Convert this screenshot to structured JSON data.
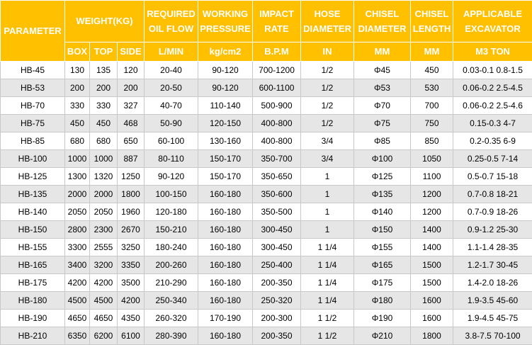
{
  "headers": {
    "parameter": "PARAMETER",
    "weight": "WEIGHT(KG)",
    "oil_flow": [
      "REQUIRED",
      "OIL FLOW"
    ],
    "pressure": [
      "WORKING",
      "PRESSURE"
    ],
    "impact": [
      "IMPACT",
      "RATE"
    ],
    "hose": [
      "HOSE",
      "DIAMETER"
    ],
    "chisel_dia": [
      "CHISEL",
      "DIAMETER"
    ],
    "chisel_len": [
      "CHISEL",
      "LENGTH"
    ],
    "excavator": [
      "APPLICABLE",
      "EXCAVATOR"
    ]
  },
  "units": {
    "box": "BOX",
    "top": "TOP",
    "side": "SIDE",
    "oil_flow": "L/MIN",
    "pressure": "kg/cm2",
    "impact": "B.P.M",
    "hose": "IN",
    "chisel_dia": "MM",
    "chisel_len": "MM",
    "excavator": "M3 TON"
  },
  "rows": [
    [
      "HB-45",
      "130",
      "135",
      "120",
      "20-40",
      "90-120",
      "700-1200",
      "1/2",
      "Φ45",
      "450",
      "0.03-0.1 0.8-1.5"
    ],
    [
      "HB-53",
      "200",
      "200",
      "200",
      "20-50",
      "90-120",
      "600-1100",
      "1/2",
      "Φ53",
      "530",
      "0.06-0.2 2.5-4.5"
    ],
    [
      "HB-70",
      "330",
      "330",
      "327",
      "40-70",
      "110-140",
      "500-900",
      "1/2",
      "Φ70",
      "700",
      "0.06-0.2 2.5-4.6"
    ],
    [
      "HB-75",
      "450",
      "450",
      "468",
      "50-90",
      "120-150",
      "400-800",
      "1/2",
      "Φ75",
      "750",
      "0.15-0.3 4-7"
    ],
    [
      "HB-85",
      "680",
      "680",
      "650",
      "60-100",
      "130-160",
      "400-800",
      "3/4",
      "Φ85",
      "850",
      "0.2-0.35 6-9"
    ],
    [
      "HB-100",
      "1000",
      "1000",
      "887",
      "80-110",
      "150-170",
      "350-700",
      "3/4",
      "Φ100",
      "1050",
      "0.25-0.5 7-14"
    ],
    [
      "HB-125",
      "1300",
      "1320",
      "1250",
      "90-120",
      "150-170",
      "350-650",
      "1",
      "Φ125",
      "1100",
      "0.5-0.7 15-18"
    ],
    [
      "HB-135",
      "2000",
      "2000",
      "1800",
      "100-150",
      "160-180",
      "350-600",
      "1",
      "Φ135",
      "1200",
      "0.7-0.8 18-21"
    ],
    [
      "HB-140",
      "2050",
      "2050",
      "1960",
      "120-180",
      "160-180",
      "350-500",
      "1",
      "Φ140",
      "1200",
      "0.7-0.9 18-26"
    ],
    [
      "HB-150",
      "2800",
      "2300",
      "2670",
      "150-210",
      "160-180",
      "300-450",
      "1",
      "Φ150",
      "1400",
      "0.9-1.2 25-30"
    ],
    [
      "HB-155",
      "3300",
      "2555",
      "3250",
      "180-240",
      "160-180",
      "300-450",
      "1 1/4",
      "Φ155",
      "1400",
      "1.1-1.4 28-35"
    ],
    [
      "HB-165",
      "3400",
      "3200",
      "3350",
      "200-260",
      "160-180",
      "250-400",
      "1 1/4",
      "Φ165",
      "1500",
      "1.2-1.7 30-45"
    ],
    [
      "HB-175",
      "4200",
      "4200",
      "3500",
      "210-290",
      "160-180",
      "200-350",
      "1 1/4",
      "Φ175",
      "1500",
      "1.4-2.0 18-26"
    ],
    [
      "HB-180",
      "4500",
      "4500",
      "4200",
      "250-340",
      "160-180",
      "250-320",
      "1 1/4",
      "Φ180",
      "1600",
      "1.9-3.5 45-60"
    ],
    [
      "HB-190",
      "4650",
      "4650",
      "4350",
      "260-320",
      "170-190",
      "200-300",
      "1 1/2",
      "Φ190",
      "1600",
      "1.9-4.5 45-75"
    ],
    [
      "HB-210",
      "6350",
      "6200",
      "6100",
      "280-390",
      "160-180",
      "200-350",
      "1 1/2",
      "Φ210",
      "1800",
      "3.8-7.5 70-100"
    ]
  ]
}
